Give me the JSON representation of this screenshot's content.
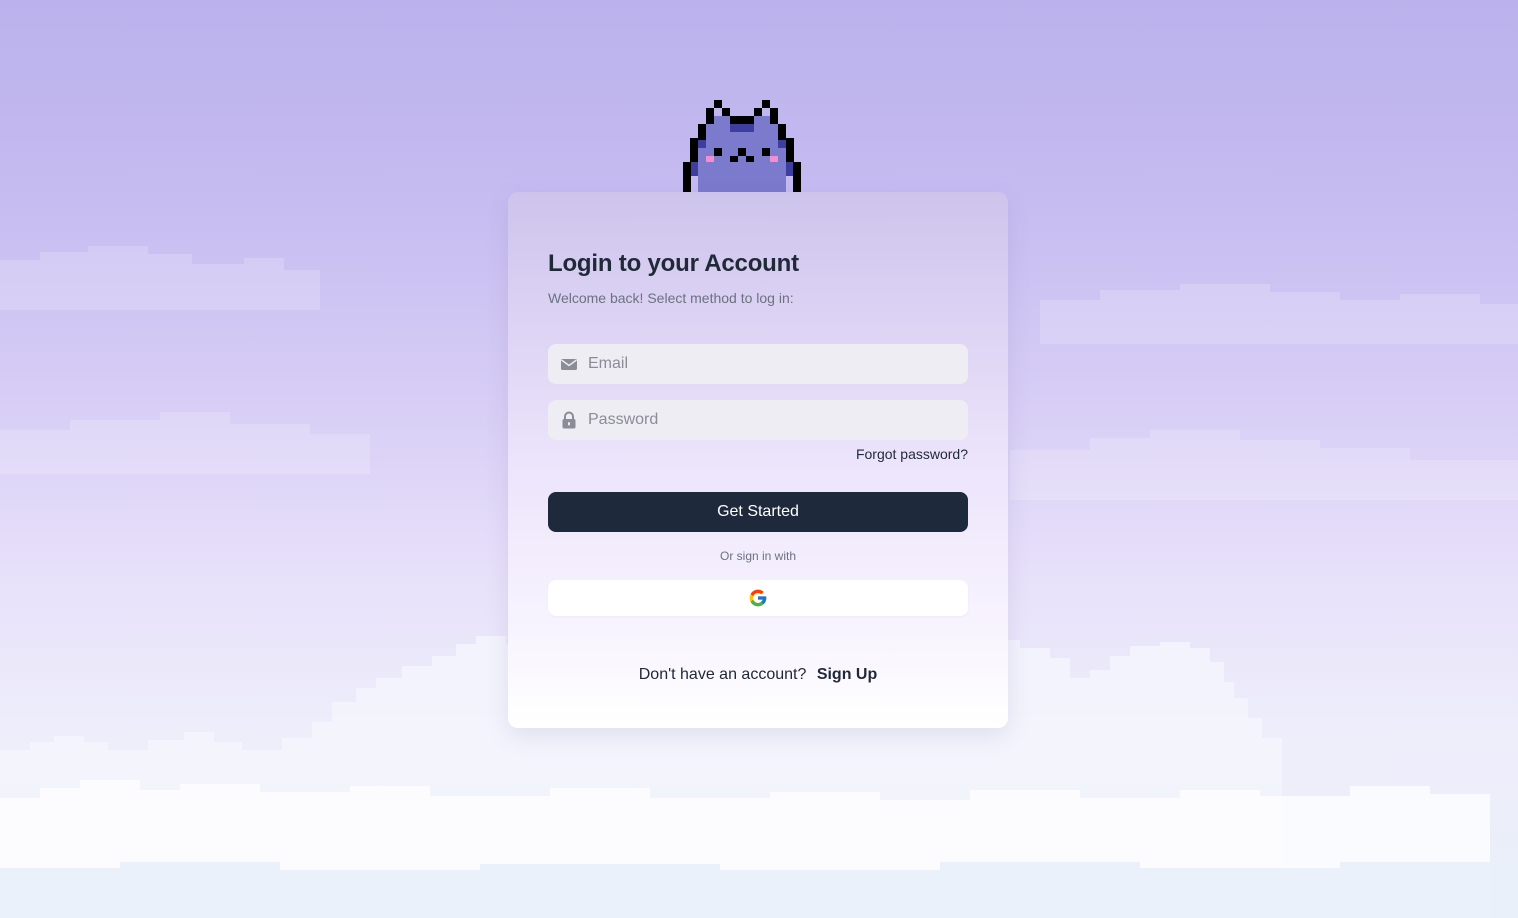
{
  "login": {
    "title": "Login to your Account",
    "subtitle": "Welcome back! Select method to log in:",
    "email": {
      "placeholder": "Email",
      "value": "",
      "icon": "envelope-icon"
    },
    "password": {
      "placeholder": "Password",
      "value": "",
      "icon": "lock-icon"
    },
    "forgot_label": "Forgot password?",
    "submit_label": "Get Started",
    "divider_label": "Or sign in with",
    "google": {
      "icon": "google-icon"
    },
    "signup_prompt": "Don't have an account?",
    "signup_label": "Sign Up"
  },
  "colors": {
    "primary_button": "#1e293b",
    "mascot_body": "#7b7acd",
    "mascot_outline": "#000000",
    "mascot_cheek": "#f38fd0"
  }
}
